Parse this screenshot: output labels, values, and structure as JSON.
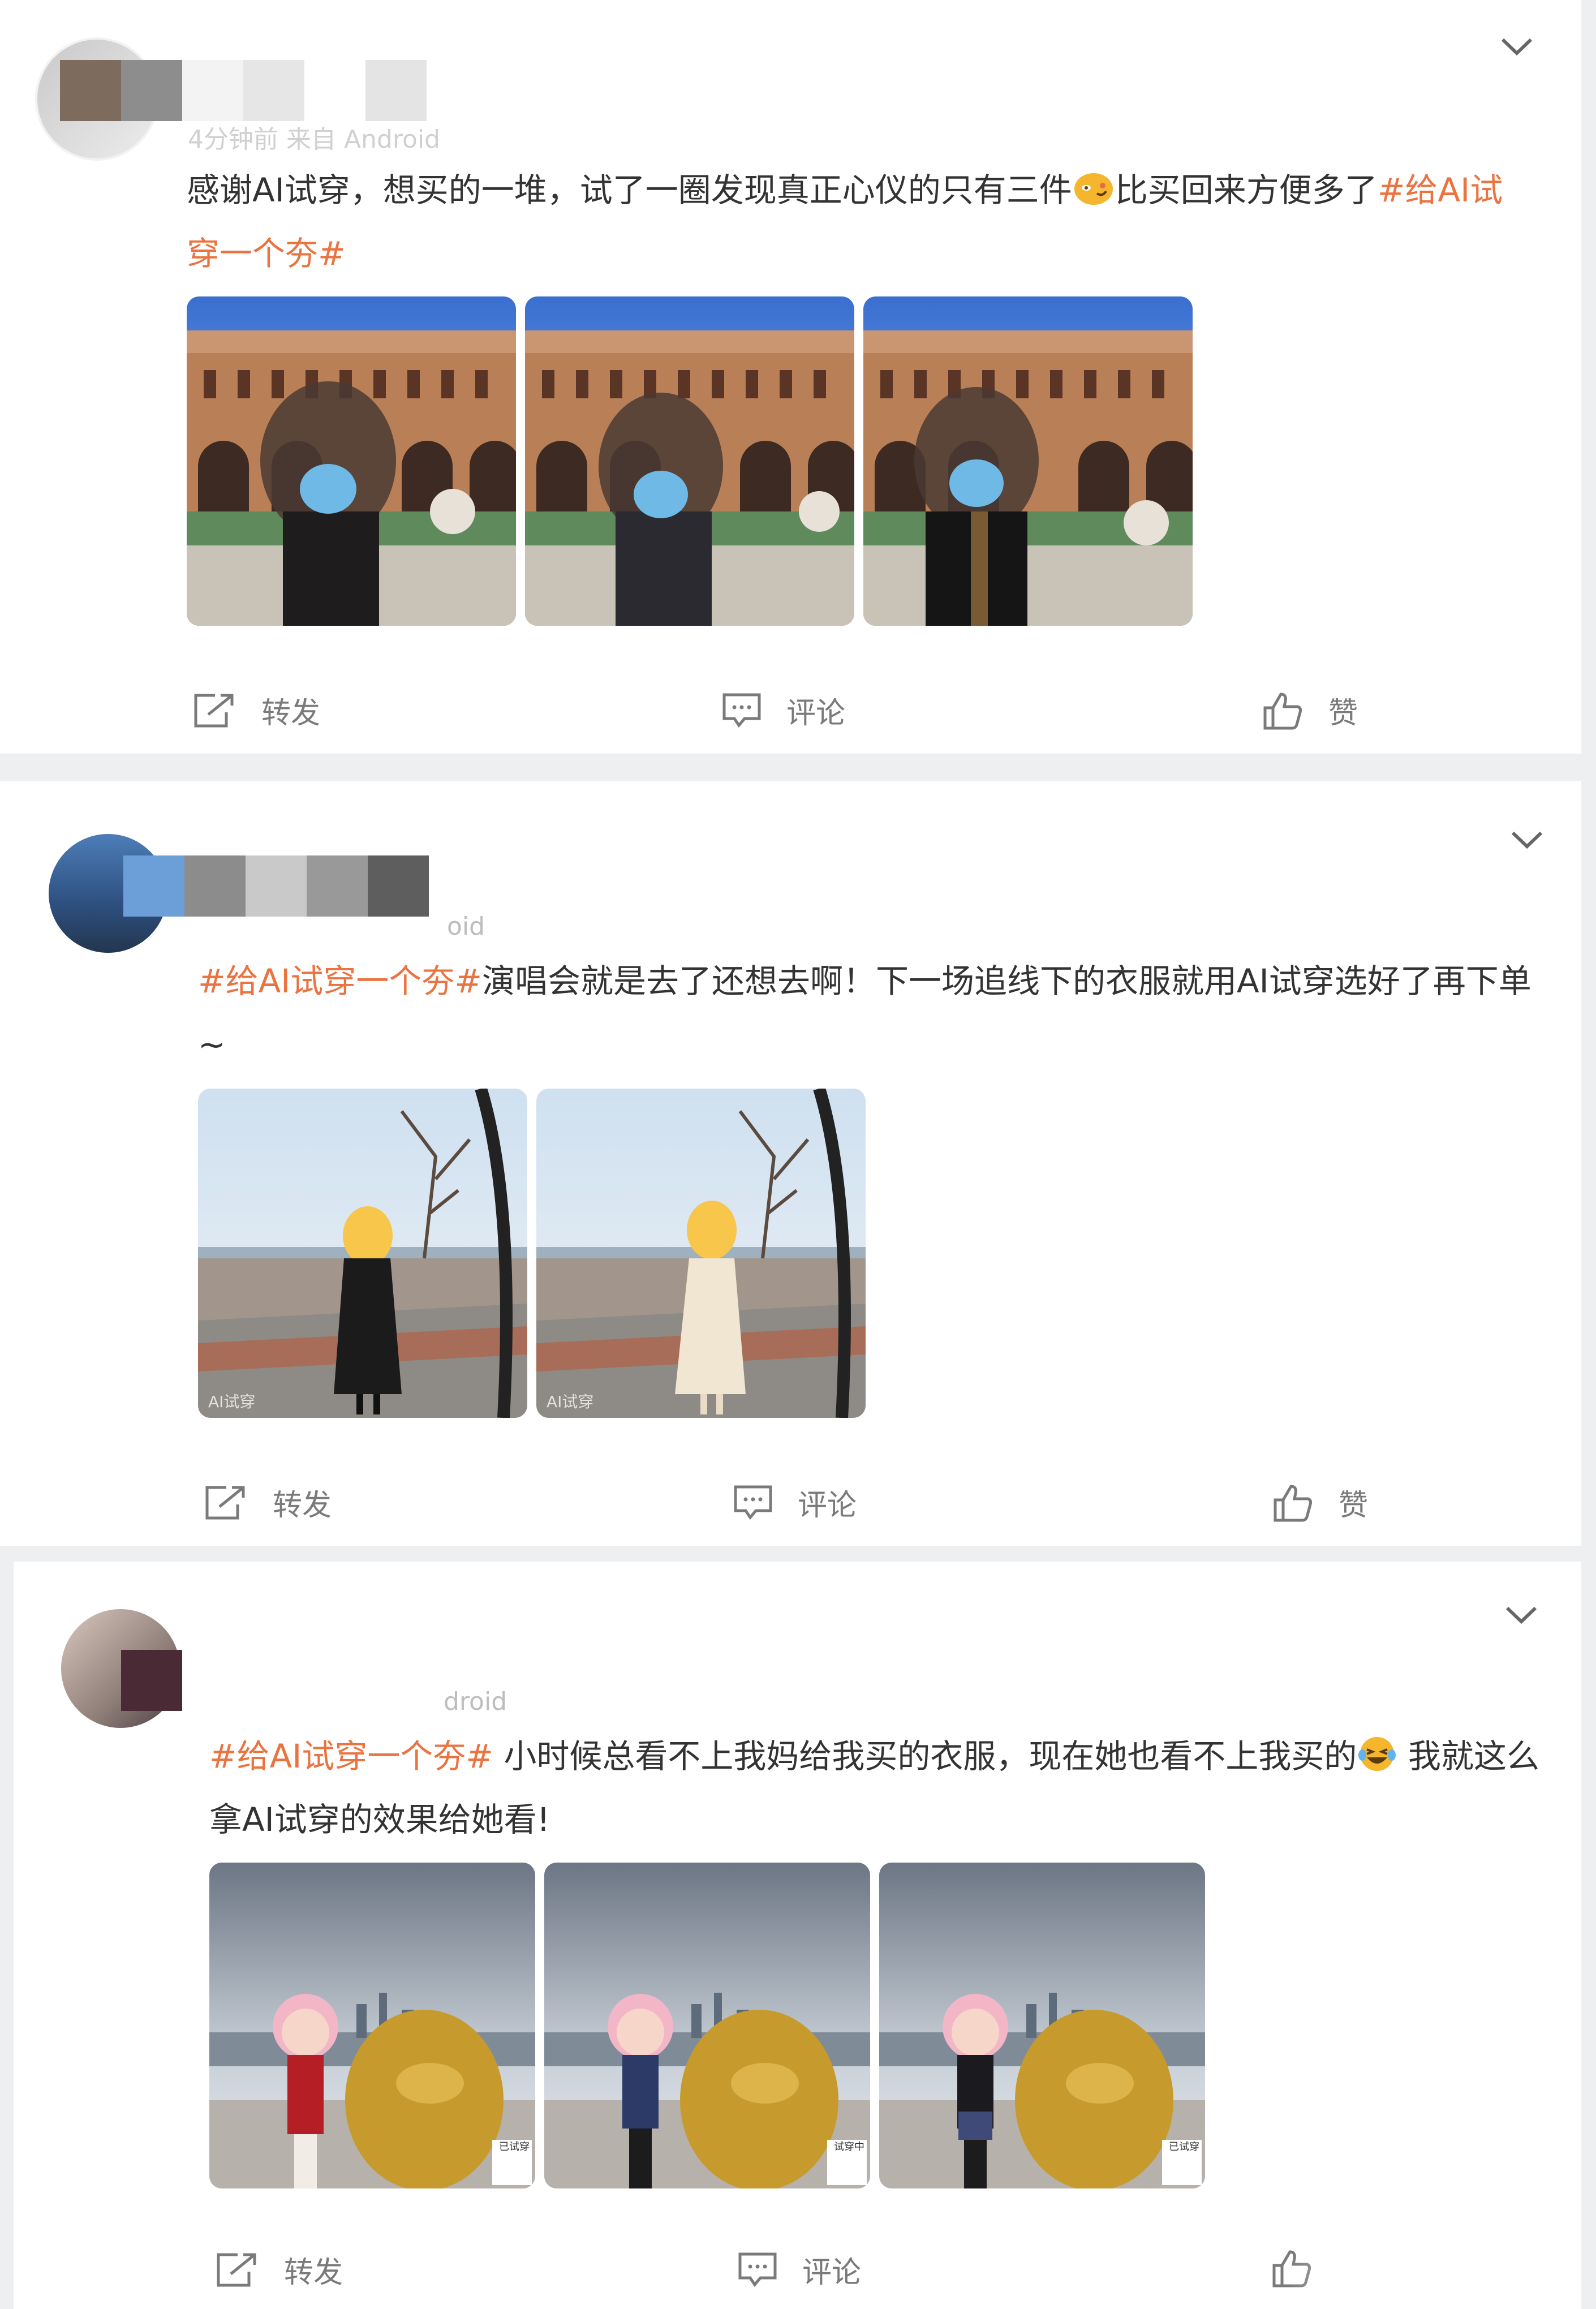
{
  "posts": [
    {
      "meta": "4分钟前  来自 Android",
      "text_a": "感谢AI试穿，想买的一堆，试了一圈发现真正心仪的只有三件",
      "text_b": "比买回来方便多了",
      "tag": "#给AI试穿一个夯#",
      "emoji": "smirk-emoji",
      "images": [
        "photo-1",
        "photo-2",
        "photo-3"
      ]
    },
    {
      "meta": "oid",
      "tag": "#给AI试穿一个夯#",
      "text": "演唱会就是去了还想去啊！下一场追线下的衣服就用AI试穿选好了再下单~",
      "images": [
        "photo-1",
        "photo-2"
      ],
      "image_watermark": "AI试穿"
    },
    {
      "meta": "droid",
      "tag": "#给AI试穿一个夯#",
      "text_a": " 小时候总看不上我妈给我买的衣服，现在她也看不上我买的",
      "text_b": " 我就这么拿AI试穿的效果给她看!",
      "emoji": "laughing-tears-emoji",
      "images": [
        "photo-1",
        "photo-2",
        "photo-3"
      ],
      "image_badges": [
        "已试穿",
        "试穿中",
        "已试穿"
      ]
    }
  ],
  "actions": {
    "repost": "转发",
    "comment": "评论",
    "like": "赞"
  },
  "colors": {
    "accent": "#eb7340",
    "text": "#333333",
    "muted": "#7a7a7a",
    "background": "#eeeff1"
  }
}
